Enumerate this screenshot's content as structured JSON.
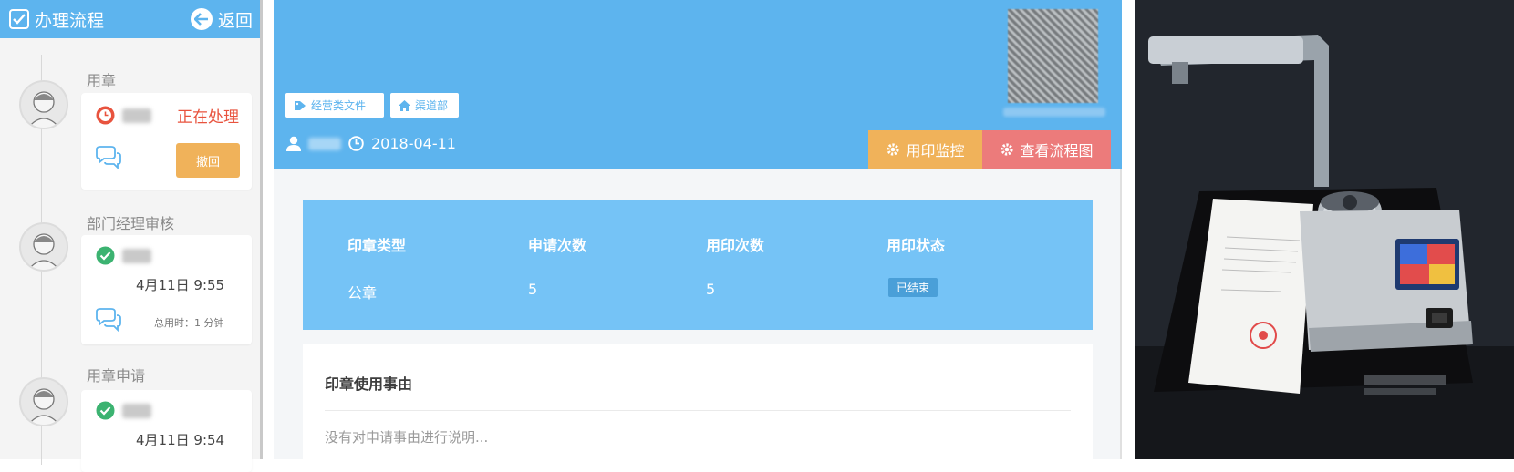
{
  "left_panel": {
    "title": "办理流程",
    "back_label": "返回",
    "steps": [
      {
        "label": "用章",
        "status": "正在处理",
        "revoke_label": "撤回"
      },
      {
        "label": "部门经理审核",
        "time": "4月11日 9:55",
        "duration": "总用时：1 分钟"
      },
      {
        "label": "用章申请",
        "time": "4月11日 9:54"
      }
    ]
  },
  "header": {
    "tags": [
      {
        "label": "经营类文件",
        "icon": "tag-icon"
      },
      {
        "label": "渠道部",
        "icon": "home-icon"
      }
    ],
    "date": "2018-04-11",
    "monitor_button": "用印监控",
    "flowchart_button": "查看流程图"
  },
  "stamp_table": {
    "headers": [
      "印章类型",
      "申请次数",
      "用印次数",
      "用印状态"
    ],
    "rows": [
      {
        "type": "公章",
        "applied": "5",
        "used": "5",
        "status": "已结束"
      }
    ]
  },
  "reason": {
    "title": "印章使用事由",
    "text": "没有对申请事由进行说明..."
  },
  "colors": {
    "primary": "#5db4ee",
    "table_bg": "#75c3f6",
    "warning": "#f0b25a",
    "danger": "#ec7b7b",
    "success": "#3cb371",
    "processing": "#e8533e"
  }
}
